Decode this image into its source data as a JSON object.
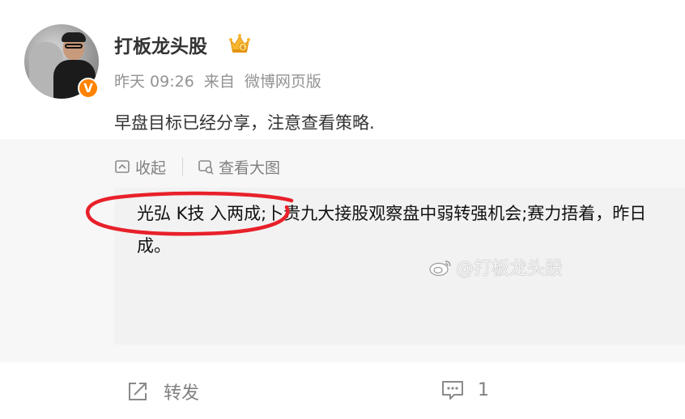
{
  "user": {
    "name": "打板龙头股",
    "verified_mark": "V"
  },
  "meta": {
    "time": "昨天 09:26",
    "source_prefix": "来自",
    "source": "微博网页版"
  },
  "post": {
    "text": "早盘目标已经分享，注意查看策略."
  },
  "media_toolbar": {
    "collapse_label": "收起",
    "view_large_label": "查看大图"
  },
  "image": {
    "line1": "光弘 K技 入两成;卜贵九大接股观察盘中弱转强机会;赛力捂着，昨日",
    "line2": "成。",
    "watermark": "@打板龙头股"
  },
  "actions": {
    "repost_label": "转发",
    "comment_count": "1"
  },
  "colors": {
    "verify_badge": "#ff8200",
    "annotation_circle": "#e8202a",
    "meta_text": "#939393"
  },
  "icons": {
    "crown": "crown-icon",
    "collapse": "collapse-icon",
    "view_large": "view-large-icon",
    "repost": "repost-icon",
    "comment": "comment-icon",
    "weibo_logo": "weibo-logo-icon"
  }
}
